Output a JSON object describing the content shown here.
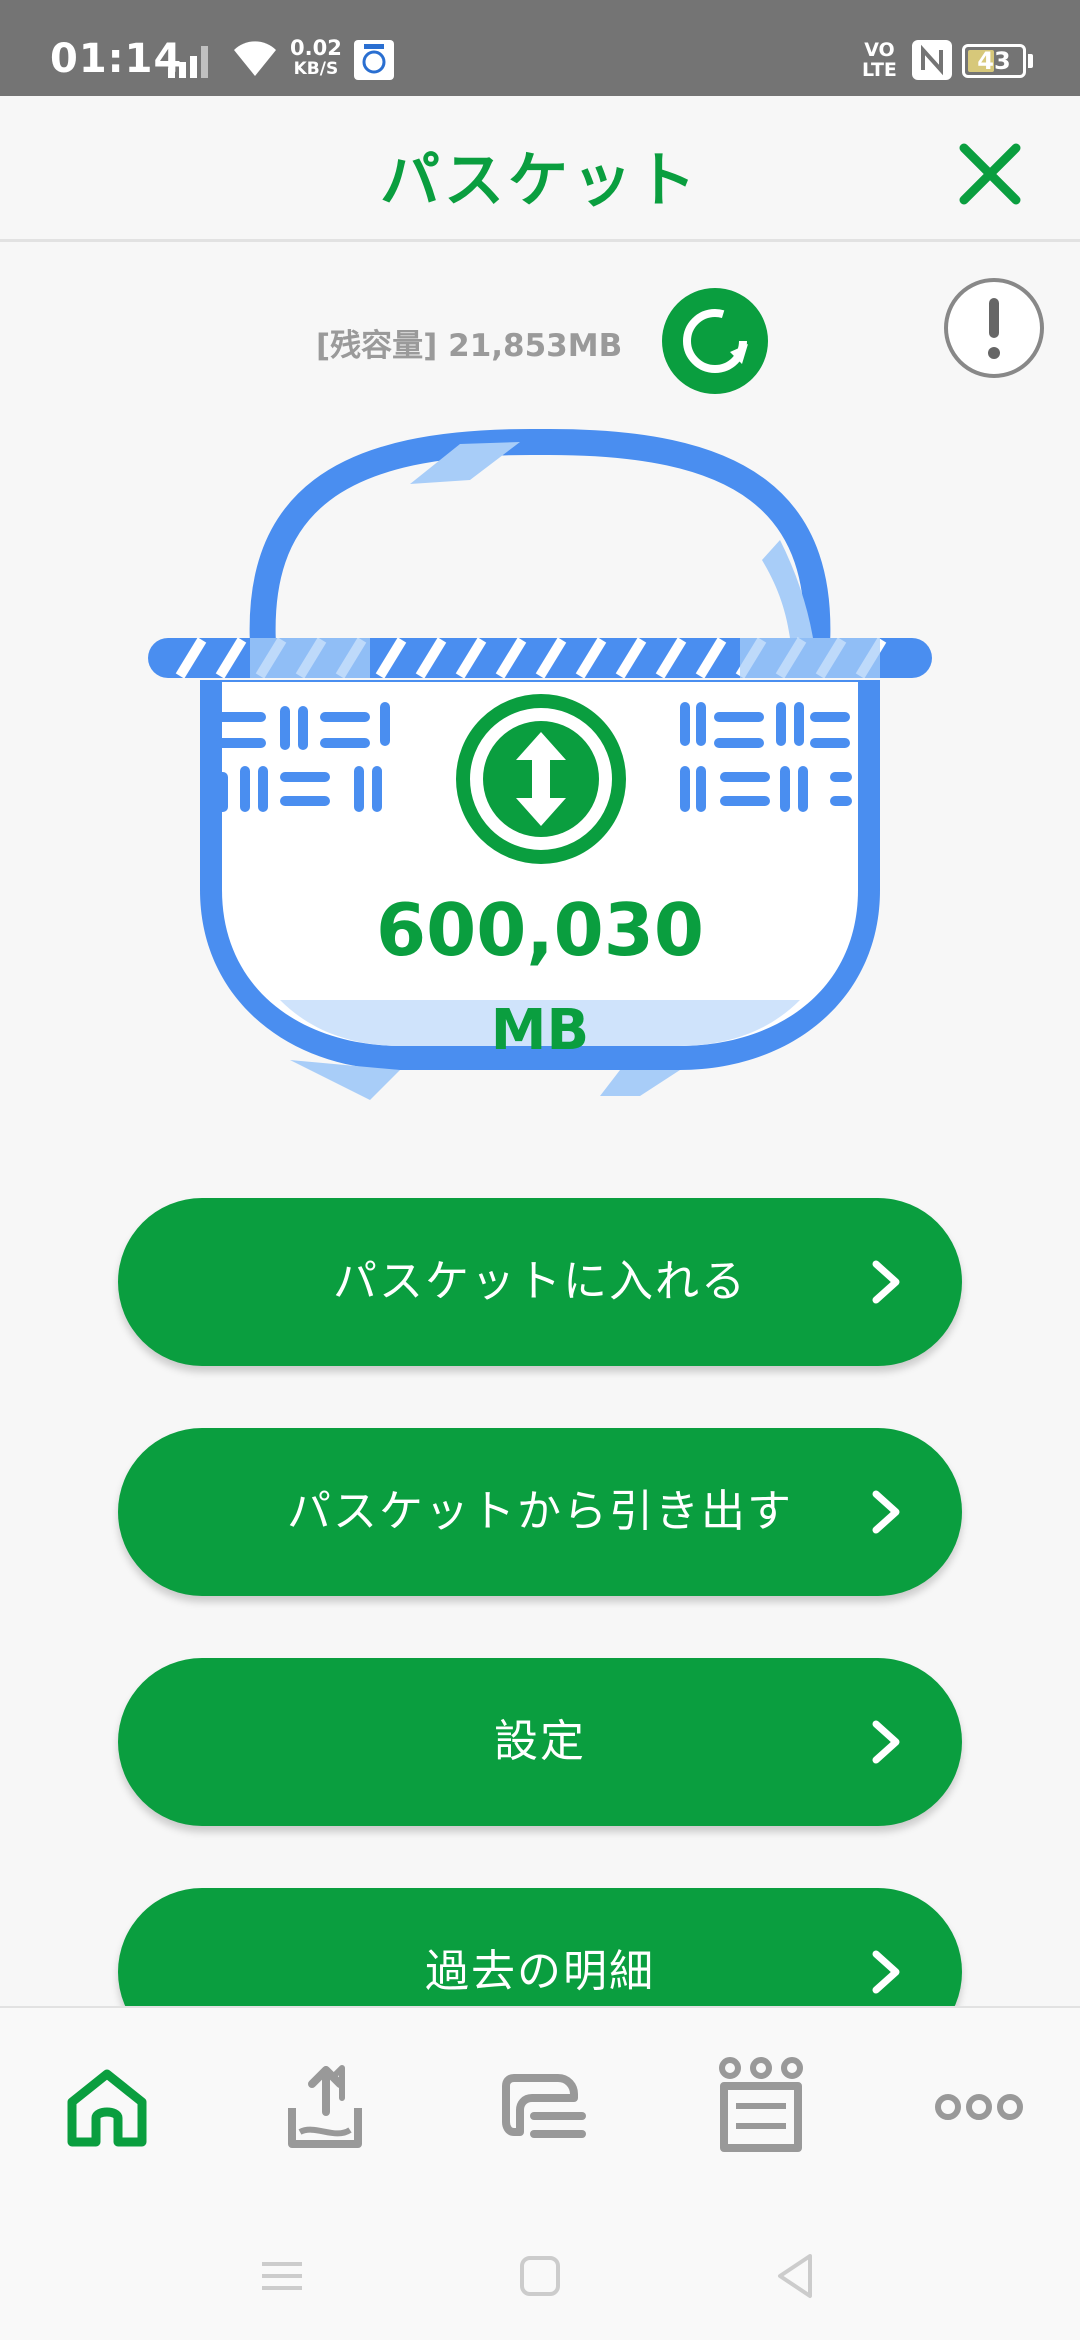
{
  "status_bar": {
    "time": "01:14",
    "speed_value": "0.02",
    "speed_unit": "KB/S",
    "volte_top": "VO",
    "volte_bottom": "LTE",
    "battery": "43"
  },
  "header": {
    "title": "パスケット",
    "close_icon": "close-icon"
  },
  "basket": {
    "remaining_label": "[残容量] 21,853MB",
    "amount": "600,030",
    "unit": "MB"
  },
  "actions": [
    {
      "label": "パスケットに入れる"
    },
    {
      "label": "パスケットから引き出す"
    },
    {
      "label": "設定"
    },
    {
      "label": "過去の明細"
    }
  ],
  "bottom_nav": [
    {
      "icon": "home-icon",
      "active": true
    },
    {
      "icon": "upload-tray-icon",
      "active": false
    },
    {
      "icon": "chat-list-icon",
      "active": false
    },
    {
      "icon": "crown-icon",
      "active": false
    },
    {
      "icon": "more-icon",
      "active": false
    }
  ],
  "colors": {
    "brand_green": "#0a9e3f",
    "basket_blue": "#4a8ef0",
    "basket_light_blue": "#a8cdf8",
    "status_bar": "#747474"
  }
}
